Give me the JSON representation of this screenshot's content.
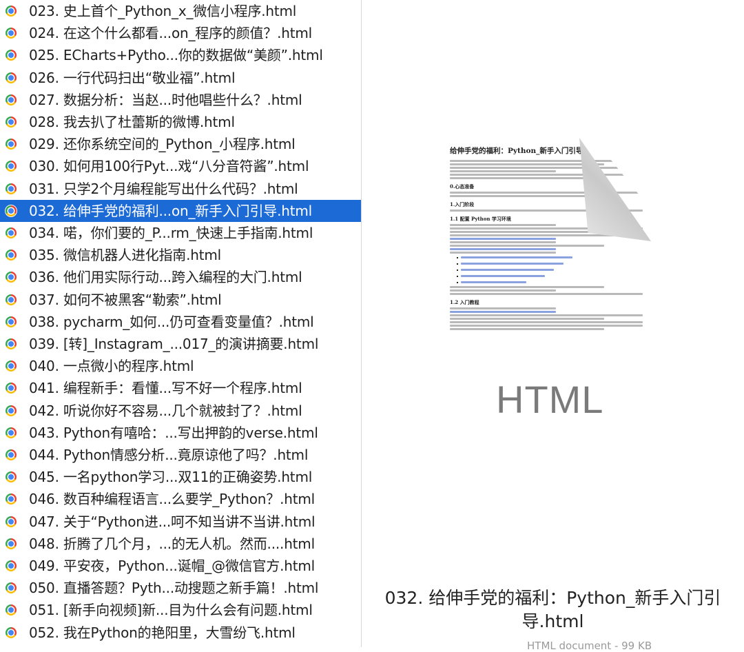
{
  "file_list": {
    "selected_index": 9,
    "items": [
      {
        "label": "023. 史上首个_Python_x_微信小程序.html",
        "icon": "chrome-icon"
      },
      {
        "label": "024. 在这个什么都看...on_程序的颜值？.html",
        "icon": "chrome-icon"
      },
      {
        "label": "025. ECharts+Pytho...你的数据做“美颜”.html",
        "icon": "chrome-icon"
      },
      {
        "label": "026. 一行代码扫出“敬业福”.html",
        "icon": "chrome-icon"
      },
      {
        "label": "027. 数据分析：当赵...时他唱些什么？.html",
        "icon": "chrome-icon"
      },
      {
        "label": "028. 我去扒了杜蕾斯的微博.html",
        "icon": "chrome-icon"
      },
      {
        "label": "029. 还你系统空间的_Python_小程序.html",
        "icon": "chrome-icon"
      },
      {
        "label": "030. 如何用100行Pyt...戏“八分音符酱”.html",
        "icon": "chrome-icon"
      },
      {
        "label": "031. 只学2个月编程能写出什么代码？.html",
        "icon": "chrome-icon"
      },
      {
        "label": "032. 给伸手党的福利...on_新手入门引导.html",
        "icon": "chrome-icon"
      },
      {
        "label": "034. 喏，你们要的_P...rm_快速上手指南.html",
        "icon": "chrome-icon"
      },
      {
        "label": "035. 微信机器人进化指南.html",
        "icon": "chrome-icon"
      },
      {
        "label": "036. 他们用实际行动...跨入编程的大门.html",
        "icon": "chrome-icon"
      },
      {
        "label": "037. 如何不被黑客“勒索”.html",
        "icon": "chrome-icon"
      },
      {
        "label": "038. pycharm_如何...仍可查看变量值？.html",
        "icon": "chrome-icon"
      },
      {
        "label": "039. [转]_Instagram_...017_的演讲摘要.html",
        "icon": "chrome-icon"
      },
      {
        "label": "040. 一点微小的程序.html",
        "icon": "chrome-icon"
      },
      {
        "label": "041. 编程新手：看懂...写不好一个程序.html",
        "icon": "chrome-icon"
      },
      {
        "label": "042. 听说你好不容易...几个就被封了？.html",
        "icon": "chrome-icon"
      },
      {
        "label": "043. Python有嘻哈：...写出押韵的verse.html",
        "icon": "chrome-icon"
      },
      {
        "label": "044. Python情感分析...竟原谅他了吗？.html",
        "icon": "chrome-icon"
      },
      {
        "label": "045. 一名python学习...双11的正确姿势.html",
        "icon": "chrome-icon"
      },
      {
        "label": "046. 数百种编程语言...么要学_Python？.html",
        "icon": "chrome-icon"
      },
      {
        "label": "047. 关于“Python进...呵不知当讲不当讲.html",
        "icon": "chrome-icon"
      },
      {
        "label": "048. 折腾了几个月，...的无人机。然而....html",
        "icon": "chrome-icon"
      },
      {
        "label": "049. 平安夜，Python...诞帽_@微信官方.html",
        "icon": "chrome-icon"
      },
      {
        "label": "050. 直播答题？Pyth...动搜题之新手篇！.html",
        "icon": "chrome-icon"
      },
      {
        "label": "051. [新手向视频]新...目为什么会有问题.html",
        "icon": "chrome-icon"
      },
      {
        "label": "052. 我在Python的艳阳里，大雪纷飞.html",
        "icon": "chrome-icon"
      }
    ]
  },
  "preview": {
    "doc_title": "给伸手党的福利：Python_新手入门引导",
    "doc_headings": [
      "0.心态准备",
      "1.入门阶段",
      "1.1 配置 Python 学习环境",
      "1.2 入门教程"
    ],
    "watermark": "HTML",
    "file_title": "032. 给伸手党的福利：Python_新手入门引导.html",
    "file_meta": "HTML document - 99 KB"
  },
  "colors": {
    "selection": "#1c6ad6",
    "text": "#1f1f1f"
  }
}
